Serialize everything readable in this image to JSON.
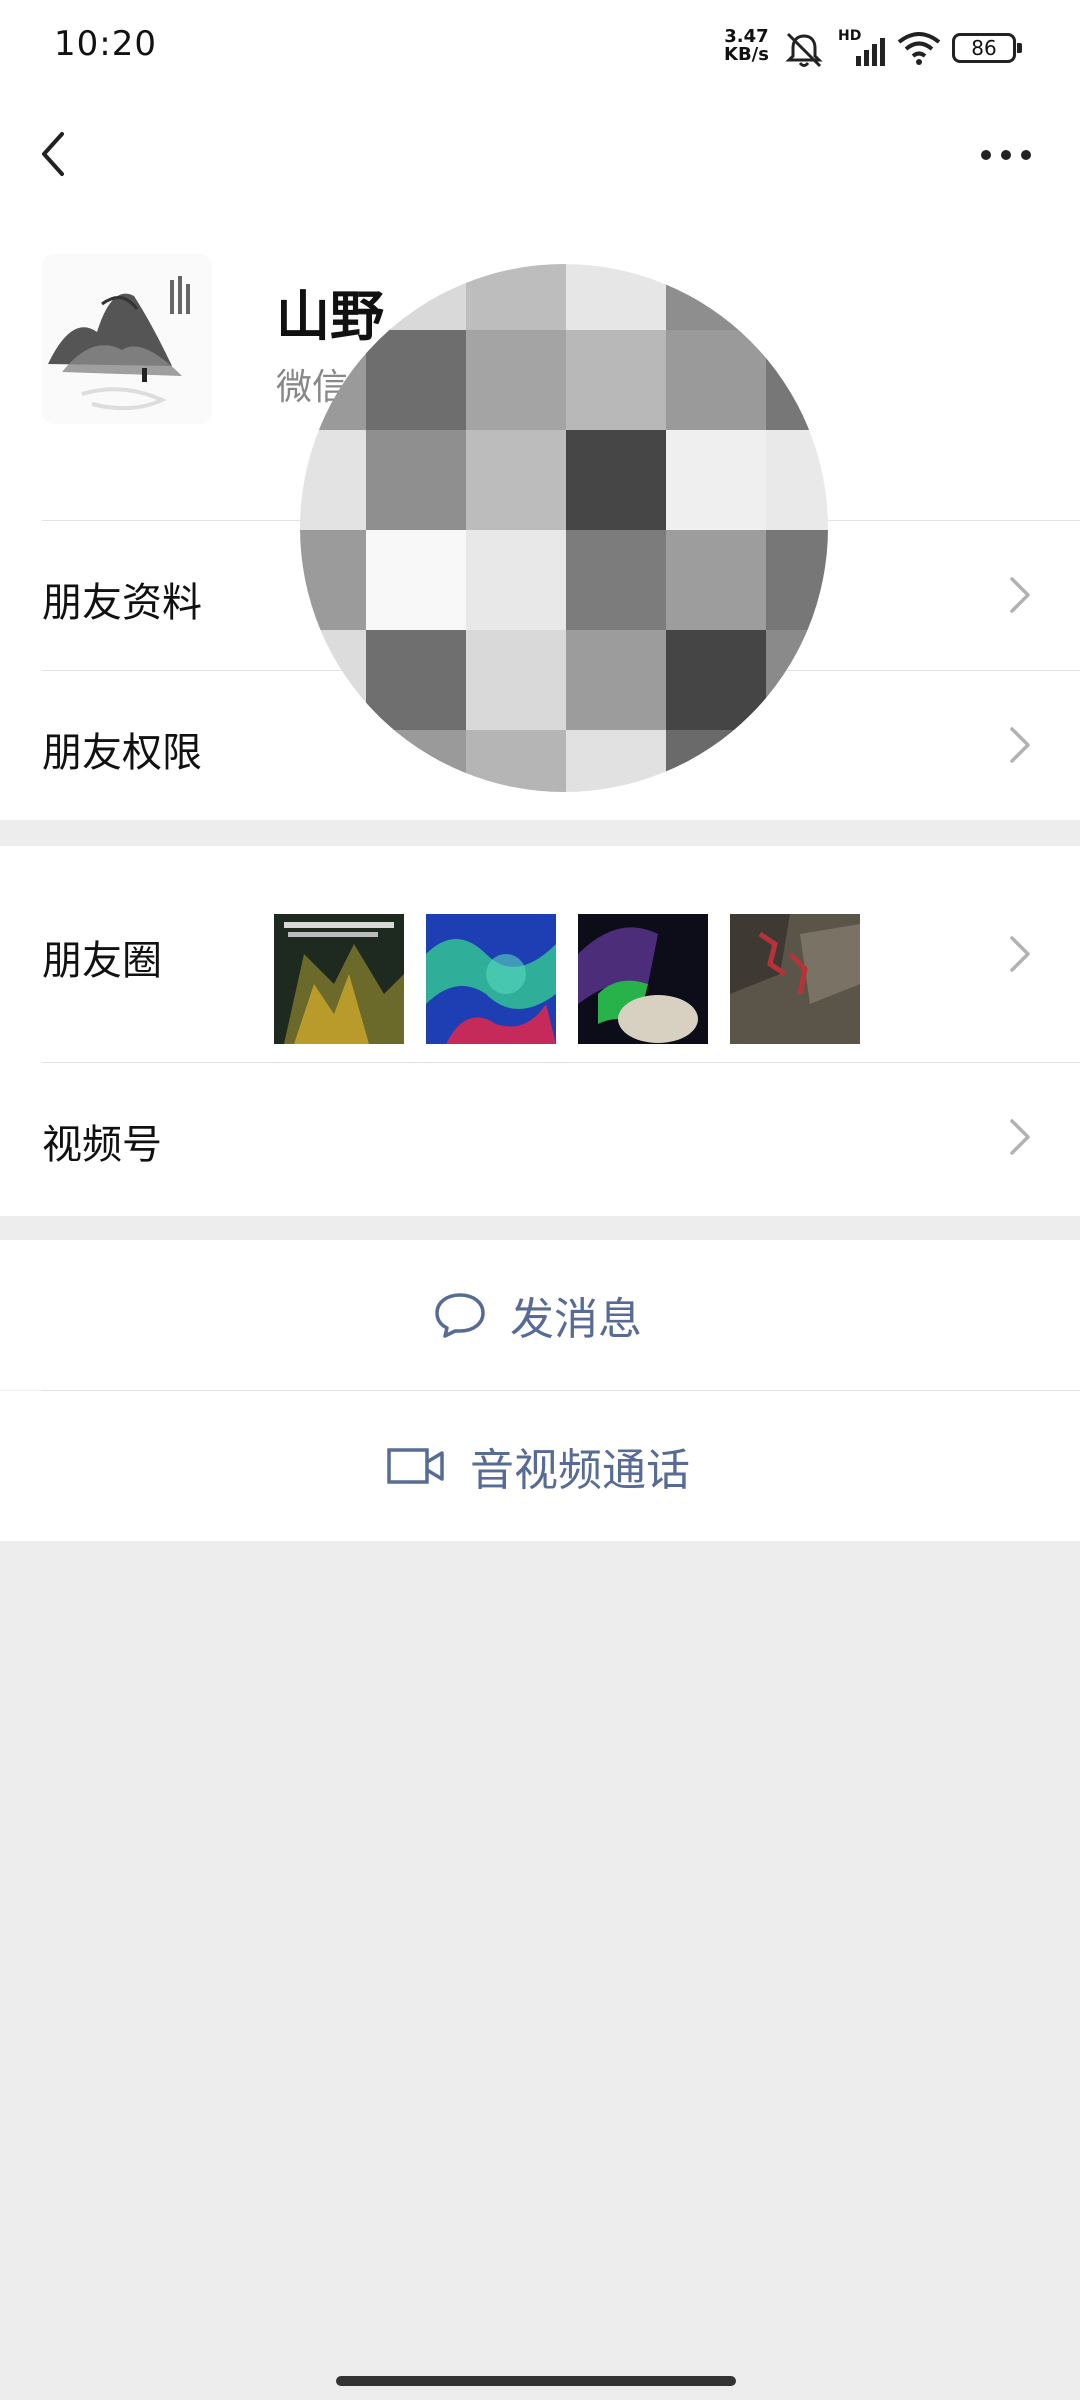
{
  "status_bar": {
    "time": "10:20",
    "net_speed_value": "3.47",
    "net_speed_unit": "KB/s",
    "network_label": "HD",
    "battery": "86"
  },
  "nav": {
    "back_icon": "chevron-left-icon",
    "more_icon": "more-dots-icon"
  },
  "profile": {
    "name": "山野",
    "sub": "微信"
  },
  "rows": {
    "friend_info": "朋友资料",
    "friend_permissions": "朋友权限",
    "moments": "朋友圈",
    "channels": "视频号"
  },
  "actions": {
    "message": "发消息",
    "call": "音视频通话"
  },
  "colors": {
    "accent_link": "#576b95",
    "background": "#ededed",
    "card": "#ffffff"
  }
}
